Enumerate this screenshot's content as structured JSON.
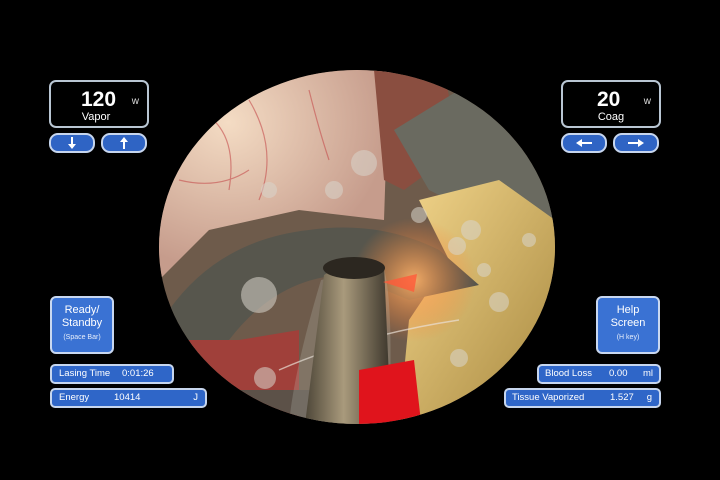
{
  "vapor_power": {
    "value": "120",
    "unit": "w",
    "mode": "Vapor"
  },
  "coag_power": {
    "value": "20",
    "unit": "w",
    "mode": "Coag"
  },
  "vapor_controls": {
    "decrease_icon": "arrow-down",
    "increase_icon": "arrow-up"
  },
  "coag_controls": {
    "decrease_icon": "arrow-left",
    "increase_icon": "arrow-right"
  },
  "ready_button": {
    "label": "Ready/\nStandby",
    "hint": "(Space Bar)"
  },
  "help_button": {
    "label": "Help\nScreen",
    "hint": "(H key)"
  },
  "stats": {
    "lasing_time": {
      "label": "Lasing Time",
      "value": "0:01:26"
    },
    "energy": {
      "label": "Energy",
      "value": "10414",
      "unit": "J"
    },
    "blood_loss": {
      "label": "Blood Loss",
      "value": "0.00",
      "unit": "ml"
    },
    "tissue_vaporized": {
      "label": "Tissue Vaporized",
      "value": "1.527",
      "unit": "g"
    }
  },
  "colors": {
    "button_blue": "#3a72d3",
    "button_border": "#c9d8f0",
    "readout_border": "#b9c6d3",
    "fiber_tip": "#e0141c"
  }
}
